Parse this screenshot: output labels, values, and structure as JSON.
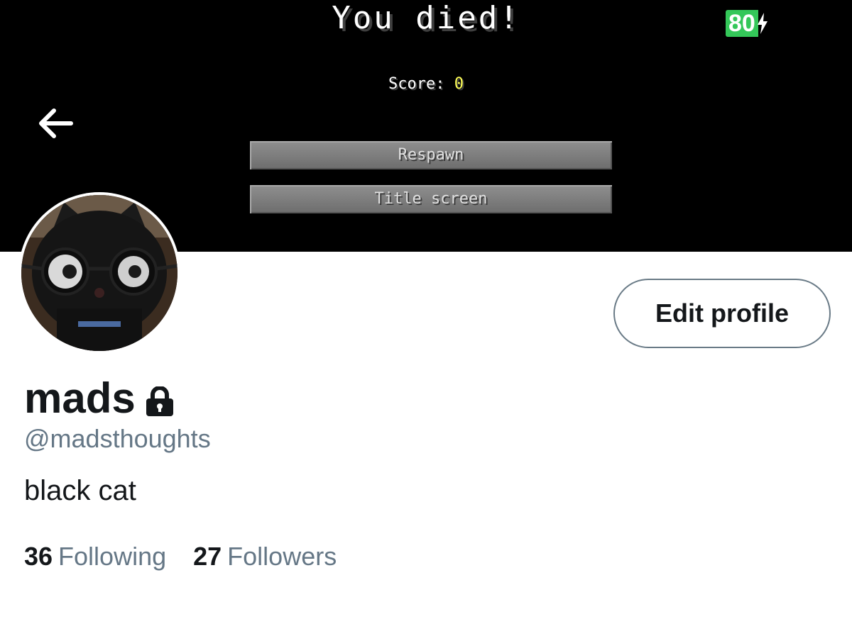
{
  "banner": {
    "title": "You died!",
    "score_label": "Score: ",
    "score_value": "0",
    "respawn_label": "Respawn",
    "title_screen_label": "Title screen"
  },
  "status_bar": {
    "battery_level": "80",
    "battery_color": "#34c759",
    "charging_icon": "bolt-icon"
  },
  "navigation": {
    "back_icon": "back-arrow-icon"
  },
  "profile": {
    "avatar_icon": "avatar",
    "edit_button_label": "Edit profile",
    "display_name": "mads",
    "protected_icon": "lock-icon",
    "handle": "@madsthoughts",
    "bio": "black cat",
    "following_count": "36",
    "following_label": "Following",
    "followers_count": "27",
    "followers_label": "Followers"
  },
  "colors": {
    "text_primary": "#14171a",
    "text_secondary": "#657786",
    "button_border": "#697a86"
  }
}
